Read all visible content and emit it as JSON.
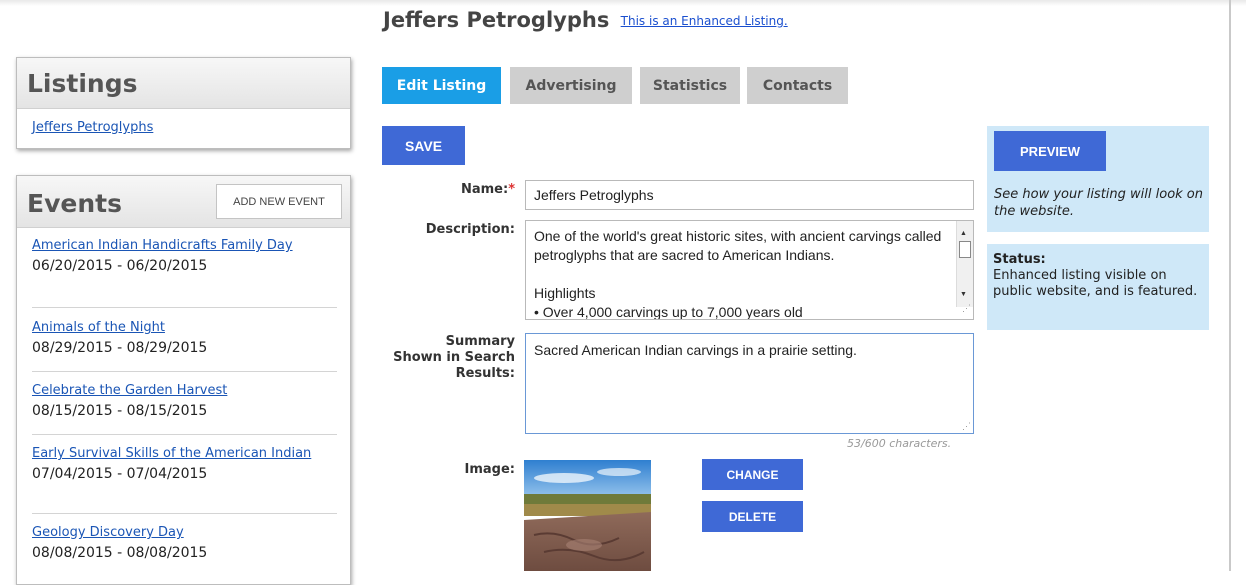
{
  "header": {
    "title": "Jeffers Petroglyphs",
    "enhanced_link": "This is an Enhanced Listing."
  },
  "listings": {
    "heading": "Listings",
    "items": [
      {
        "label": "Jeffers Petroglyphs"
      }
    ]
  },
  "events": {
    "heading": "Events",
    "add_button": "ADD NEW EVENT",
    "items": [
      {
        "title": "American Indian Handicrafts Family Day",
        "dates": "06/20/2015 - 06/20/2015"
      },
      {
        "title": "Animals of the Night",
        "dates": "08/29/2015 - 08/29/2015"
      },
      {
        "title": "Celebrate the Garden Harvest",
        "dates": "08/15/2015 - 08/15/2015"
      },
      {
        "title": "Early Survival Skills of the American Indian",
        "dates": "07/04/2015 - 07/04/2015"
      },
      {
        "title": "Geology Discovery Day",
        "dates": "08/08/2015 - 08/08/2015"
      }
    ]
  },
  "tabs": [
    {
      "label": "Edit Listing",
      "active": true
    },
    {
      "label": "Advertising",
      "active": false
    },
    {
      "label": "Statistics",
      "active": false
    },
    {
      "label": "Contacts",
      "active": false
    }
  ],
  "form": {
    "save_label": "SAVE",
    "name_label": "Name:",
    "required_mark": "*",
    "name_value": "Jeffers Petroglyphs",
    "description_label": "Description:",
    "description_lines": [
      "One of the world's great historic sites, with ancient carvings called petroglyphs that are sacred to American Indians.",
      "",
      "Highlights",
      "• Over 4,000 carvings up to 7,000 years old"
    ],
    "summary_label_1": "Summary",
    "summary_label_2": "Shown in Search",
    "summary_label_3": "Results:",
    "summary_value": "Sacred American Indian carvings in a prairie setting.",
    "char_count": "53/600 characters.",
    "image_label": "Image:",
    "change_label": "CHANGE",
    "delete_label": "DELETE"
  },
  "preview": {
    "button_label": "PREVIEW",
    "text": "See how your listing will look on the website."
  },
  "status": {
    "heading": "Status:",
    "text": "Enhanced listing visible on public website, and is featured."
  },
  "colors": {
    "accent_blue": "#3f69d6",
    "active_tab": "#1a9ee6",
    "side_panel": "#cfe8f8",
    "link": "#1a55b5"
  }
}
